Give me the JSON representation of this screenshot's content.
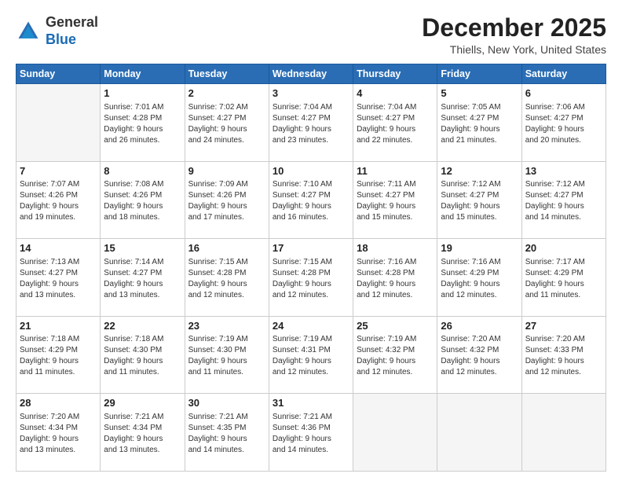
{
  "header": {
    "logo_general": "General",
    "logo_blue": "Blue",
    "month_title": "December 2025",
    "location": "Thiells, New York, United States"
  },
  "days_of_week": [
    "Sunday",
    "Monday",
    "Tuesday",
    "Wednesday",
    "Thursday",
    "Friday",
    "Saturday"
  ],
  "weeks": [
    [
      {
        "day": "",
        "info": ""
      },
      {
        "day": "1",
        "info": "Sunrise: 7:01 AM\nSunset: 4:28 PM\nDaylight: 9 hours\nand 26 minutes."
      },
      {
        "day": "2",
        "info": "Sunrise: 7:02 AM\nSunset: 4:27 PM\nDaylight: 9 hours\nand 24 minutes."
      },
      {
        "day": "3",
        "info": "Sunrise: 7:04 AM\nSunset: 4:27 PM\nDaylight: 9 hours\nand 23 minutes."
      },
      {
        "day": "4",
        "info": "Sunrise: 7:04 AM\nSunset: 4:27 PM\nDaylight: 9 hours\nand 22 minutes."
      },
      {
        "day": "5",
        "info": "Sunrise: 7:05 AM\nSunset: 4:27 PM\nDaylight: 9 hours\nand 21 minutes."
      },
      {
        "day": "6",
        "info": "Sunrise: 7:06 AM\nSunset: 4:27 PM\nDaylight: 9 hours\nand 20 minutes."
      }
    ],
    [
      {
        "day": "7",
        "info": "Sunrise: 7:07 AM\nSunset: 4:26 PM\nDaylight: 9 hours\nand 19 minutes."
      },
      {
        "day": "8",
        "info": "Sunrise: 7:08 AM\nSunset: 4:26 PM\nDaylight: 9 hours\nand 18 minutes."
      },
      {
        "day": "9",
        "info": "Sunrise: 7:09 AM\nSunset: 4:26 PM\nDaylight: 9 hours\nand 17 minutes."
      },
      {
        "day": "10",
        "info": "Sunrise: 7:10 AM\nSunset: 4:27 PM\nDaylight: 9 hours\nand 16 minutes."
      },
      {
        "day": "11",
        "info": "Sunrise: 7:11 AM\nSunset: 4:27 PM\nDaylight: 9 hours\nand 15 minutes."
      },
      {
        "day": "12",
        "info": "Sunrise: 7:12 AM\nSunset: 4:27 PM\nDaylight: 9 hours\nand 15 minutes."
      },
      {
        "day": "13",
        "info": "Sunrise: 7:12 AM\nSunset: 4:27 PM\nDaylight: 9 hours\nand 14 minutes."
      }
    ],
    [
      {
        "day": "14",
        "info": "Sunrise: 7:13 AM\nSunset: 4:27 PM\nDaylight: 9 hours\nand 13 minutes."
      },
      {
        "day": "15",
        "info": "Sunrise: 7:14 AM\nSunset: 4:27 PM\nDaylight: 9 hours\nand 13 minutes."
      },
      {
        "day": "16",
        "info": "Sunrise: 7:15 AM\nSunset: 4:28 PM\nDaylight: 9 hours\nand 12 minutes."
      },
      {
        "day": "17",
        "info": "Sunrise: 7:15 AM\nSunset: 4:28 PM\nDaylight: 9 hours\nand 12 minutes."
      },
      {
        "day": "18",
        "info": "Sunrise: 7:16 AM\nSunset: 4:28 PM\nDaylight: 9 hours\nand 12 minutes."
      },
      {
        "day": "19",
        "info": "Sunrise: 7:16 AM\nSunset: 4:29 PM\nDaylight: 9 hours\nand 12 minutes."
      },
      {
        "day": "20",
        "info": "Sunrise: 7:17 AM\nSunset: 4:29 PM\nDaylight: 9 hours\nand 11 minutes."
      }
    ],
    [
      {
        "day": "21",
        "info": "Sunrise: 7:18 AM\nSunset: 4:29 PM\nDaylight: 9 hours\nand 11 minutes."
      },
      {
        "day": "22",
        "info": "Sunrise: 7:18 AM\nSunset: 4:30 PM\nDaylight: 9 hours\nand 11 minutes."
      },
      {
        "day": "23",
        "info": "Sunrise: 7:19 AM\nSunset: 4:30 PM\nDaylight: 9 hours\nand 11 minutes."
      },
      {
        "day": "24",
        "info": "Sunrise: 7:19 AM\nSunset: 4:31 PM\nDaylight: 9 hours\nand 12 minutes."
      },
      {
        "day": "25",
        "info": "Sunrise: 7:19 AM\nSunset: 4:32 PM\nDaylight: 9 hours\nand 12 minutes."
      },
      {
        "day": "26",
        "info": "Sunrise: 7:20 AM\nSunset: 4:32 PM\nDaylight: 9 hours\nand 12 minutes."
      },
      {
        "day": "27",
        "info": "Sunrise: 7:20 AM\nSunset: 4:33 PM\nDaylight: 9 hours\nand 12 minutes."
      }
    ],
    [
      {
        "day": "28",
        "info": "Sunrise: 7:20 AM\nSunset: 4:34 PM\nDaylight: 9 hours\nand 13 minutes."
      },
      {
        "day": "29",
        "info": "Sunrise: 7:21 AM\nSunset: 4:34 PM\nDaylight: 9 hours\nand 13 minutes."
      },
      {
        "day": "30",
        "info": "Sunrise: 7:21 AM\nSunset: 4:35 PM\nDaylight: 9 hours\nand 14 minutes."
      },
      {
        "day": "31",
        "info": "Sunrise: 7:21 AM\nSunset: 4:36 PM\nDaylight: 9 hours\nand 14 minutes."
      },
      {
        "day": "",
        "info": ""
      },
      {
        "day": "",
        "info": ""
      },
      {
        "day": "",
        "info": ""
      }
    ]
  ]
}
